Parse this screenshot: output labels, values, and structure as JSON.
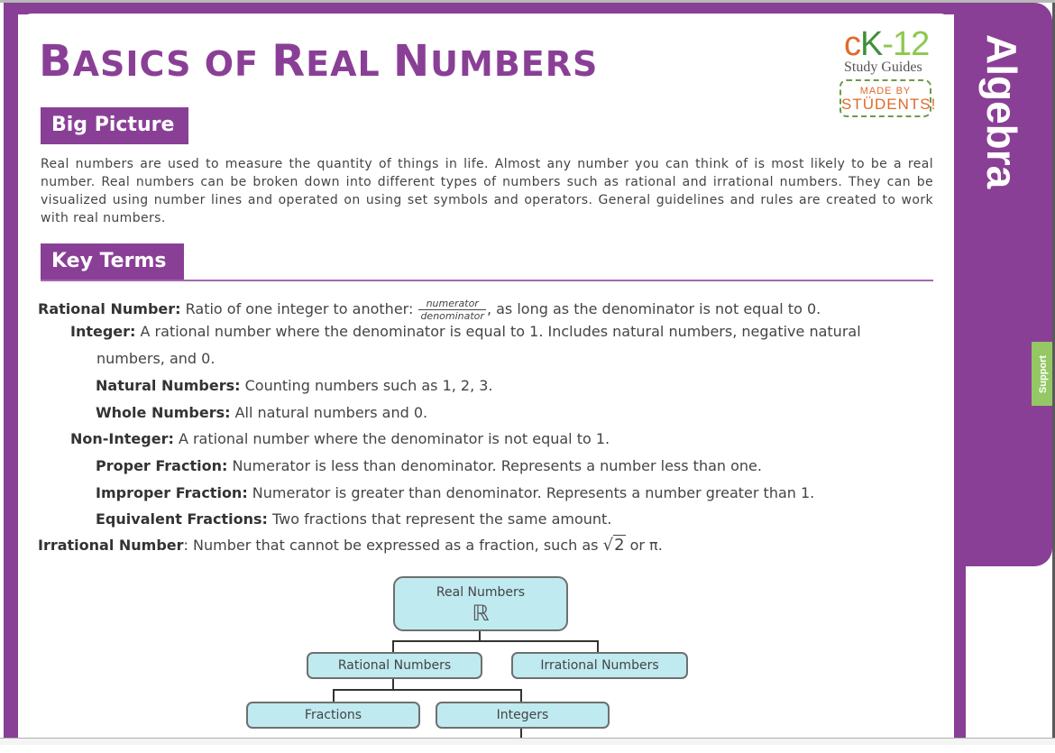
{
  "document": {
    "title_parts": [
      {
        "text": "B",
        "size": "big"
      },
      {
        "text": "ASICS OF ",
        "size": "sm"
      },
      {
        "text": "R",
        "size": "big"
      },
      {
        "text": "EAL ",
        "size": "sm"
      },
      {
        "text": "N",
        "size": "big"
      },
      {
        "text": "UMBERS",
        "size": "sm"
      }
    ],
    "title": "Basics of Real Numbers",
    "subject_tab": "Algebra",
    "support_tab": "Support",
    "brand_color": "#8a3f96"
  },
  "logo": {
    "ck_c": "c",
    "ck_k": "K",
    "ck_num": "-12",
    "study_guides": "Study Guides",
    "badge_line1": "MADE BY",
    "badge_line2": "STÜDENTS!"
  },
  "big_picture": {
    "heading": "Big Picture",
    "text": "Real numbers are used to measure the quantity of things in life. Almost any number you can think of is most likely to be a real number. Real numbers can be broken down into different types of numbers such as rational and irrational numbers. They can be visualized using number lines and operated on using set symbols and operators. General guidelines and rules are created to work with real numbers."
  },
  "key_terms": {
    "heading": "Key Terms",
    "rational": {
      "term": "Rational Number:",
      "text_before": " Ratio of one integer to another: ",
      "frac_num": "numerator",
      "frac_den": "denominator",
      "text_after": ", as long as the denominator is not equal to 0."
    },
    "integer": {
      "term": "Integer:",
      "text": " A rational number where the denominator is equal to 1. Includes natural numbers, negative natural",
      "text_cont": "numbers, and 0."
    },
    "natural": {
      "term": "Natural Numbers:",
      "text": " Counting numbers such as 1, 2, 3."
    },
    "whole": {
      "term": "Whole Numbers:",
      "text": " All natural numbers and 0."
    },
    "non_integer": {
      "term": "Non-Integer:",
      "text": " A rational number where the denominator is not equal to 1."
    },
    "proper": {
      "term": "Proper Fraction:",
      "text": " Numerator is less than denominator. Represents a number less than one."
    },
    "improper": {
      "term": "Improper Fraction:",
      "text": " Numerator is greater than denominator. Represents a number greater than 1."
    },
    "equivalent": {
      "term": "Equivalent Fractions:",
      "text": " Two fractions that represent the same amount."
    },
    "irrational": {
      "term": "Irrational Number",
      "text_before": ": Number that cannot be expressed as a fraction, such as ",
      "sqrt_symbol": "√",
      "sqrt_value": "2",
      "text_after": " or π."
    }
  },
  "diagram": {
    "root": {
      "label": "Real Numbers",
      "symbol": "ℝ"
    },
    "rational": "Rational Numbers",
    "irrational": "Irrational Numbers",
    "fractions": "Fractions",
    "integers": "Integers"
  }
}
